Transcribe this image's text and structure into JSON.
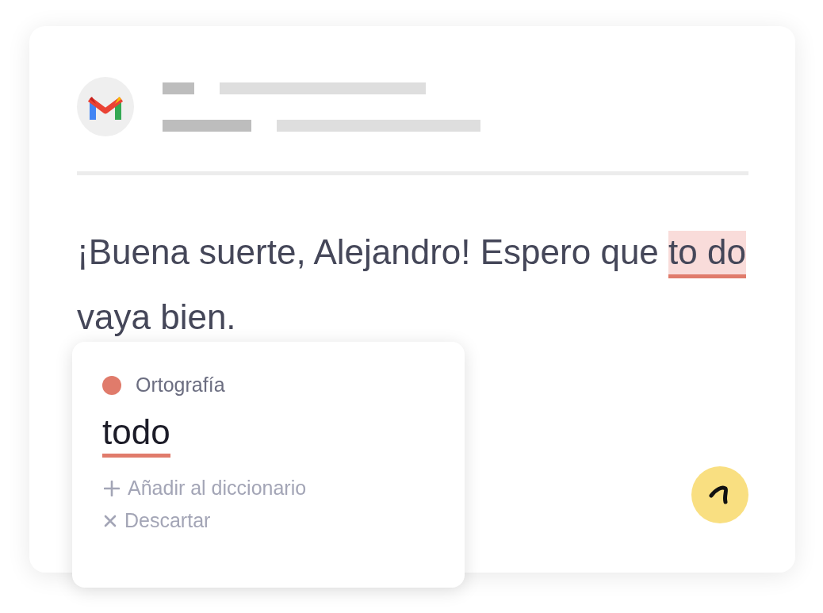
{
  "message": {
    "parts": [
      {
        "kind": "plain",
        "text": "¡Buena suerte, Alejandro! Espero que"
      },
      {
        "kind": "flagged",
        "text": "to do"
      },
      {
        "kind": "plain",
        "text": "vaya bien."
      }
    ]
  },
  "suggestion_card": {
    "category": {
      "label": "Ortografía",
      "color": "#e07b6b"
    },
    "replacement": "todo",
    "actions": [
      {
        "kind": "add",
        "label": "Añadir al diccionario"
      },
      {
        "kind": "dismiss",
        "label": "Descartar"
      }
    ]
  }
}
